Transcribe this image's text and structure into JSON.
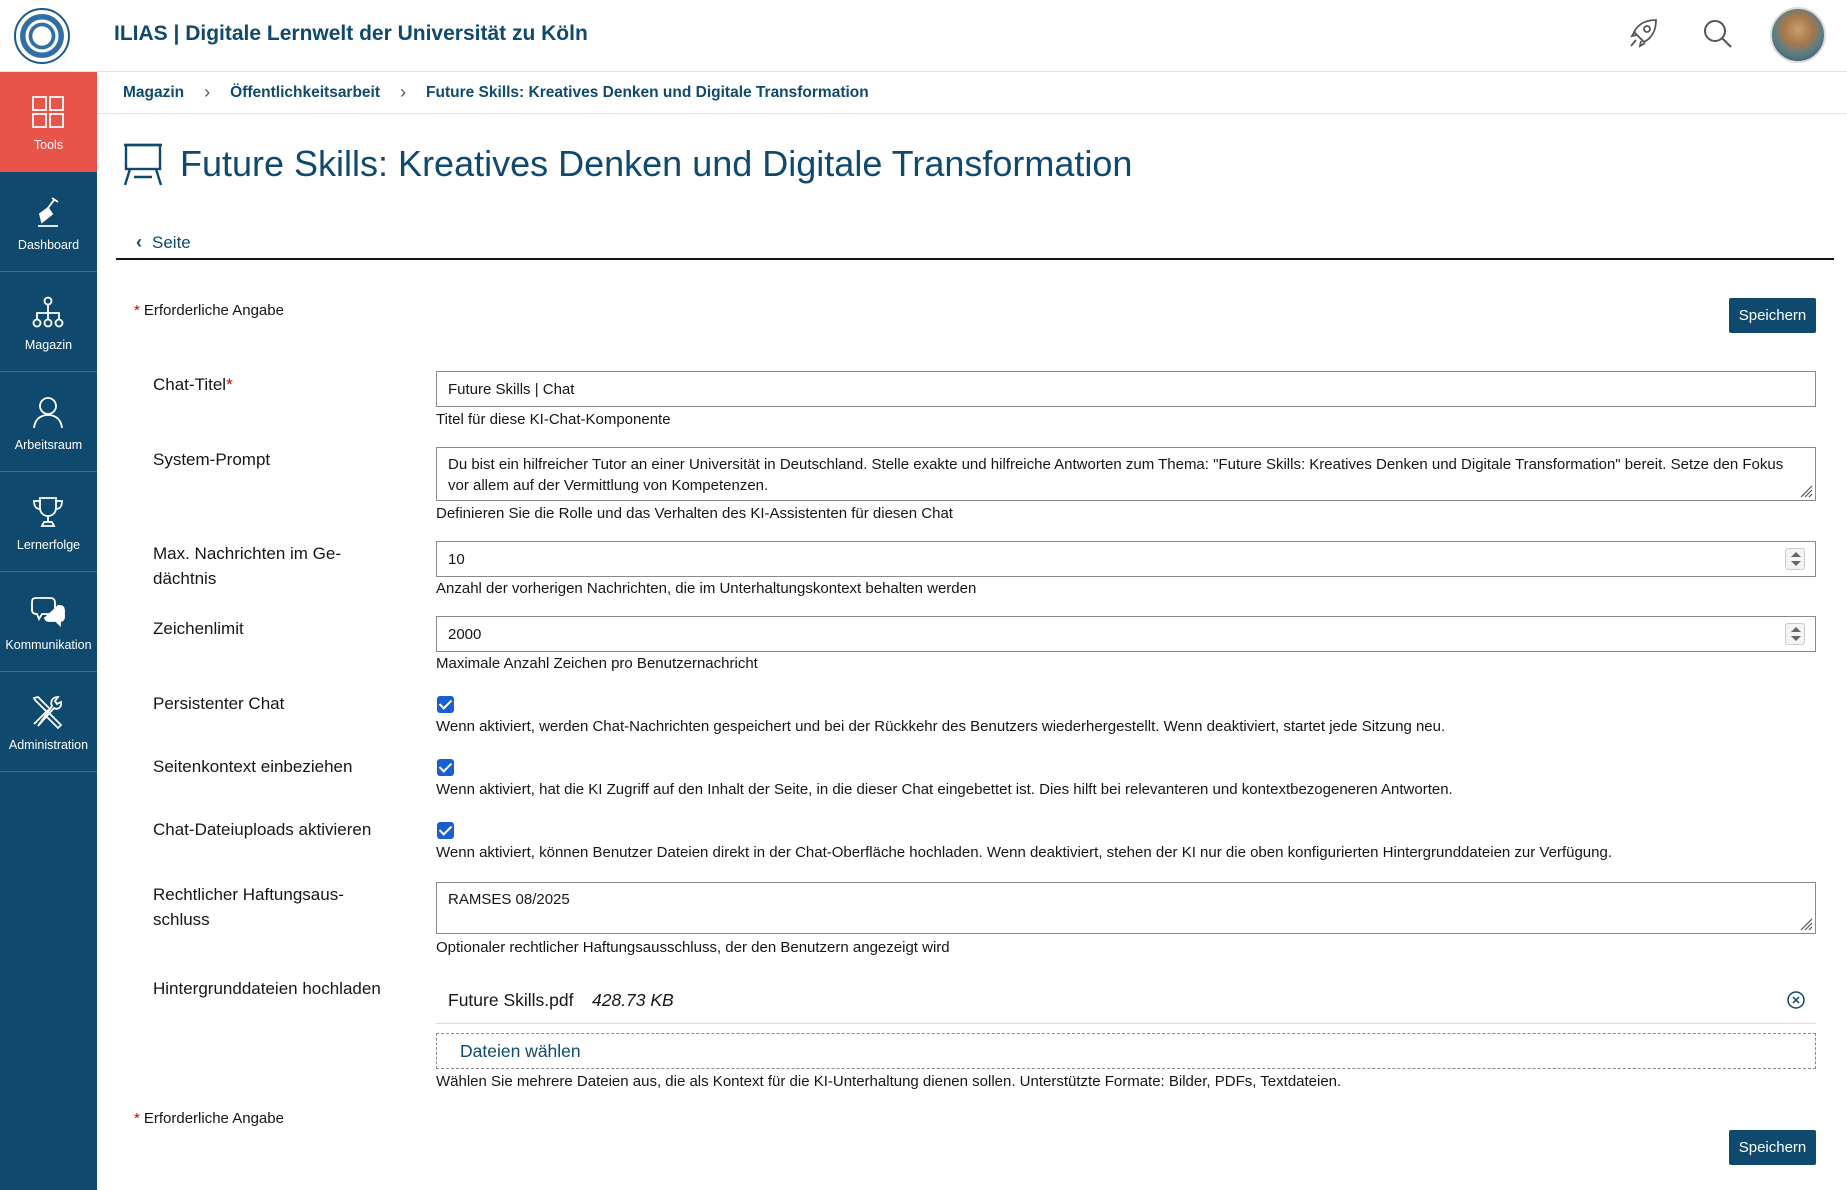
{
  "header": {
    "app_title": "ILIAS | Digitale Lernwelt der Universität zu Köln"
  },
  "sidebar": {
    "items": [
      {
        "label": "Tools",
        "icon": "tools-grid-icon",
        "active": true
      },
      {
        "label": "Dashboard",
        "icon": "dashboard-icon"
      },
      {
        "label": "Magazin",
        "icon": "magazin-tree-icon"
      },
      {
        "label": "Arbeitsraum",
        "icon": "person-icon"
      },
      {
        "label": "Lernerfolge",
        "icon": "trophy-icon"
      },
      {
        "label": "Kommunikation",
        "icon": "chat-bubbles-icon"
      },
      {
        "label": "Administration",
        "icon": "wrench-screwdriver-icon"
      }
    ]
  },
  "breadcrumb": [
    "Magazin",
    "Öffentlichkeitsarbeit",
    "Future Skills: Kreatives Denken und Digitale Transformation"
  ],
  "page": {
    "title": "Future Skills: Kreatives Denken und Digitale Transformation",
    "back_label": "Seite",
    "required_note": "Erforderliche Angabe",
    "save_label": "Speichern"
  },
  "form": {
    "chat_title": {
      "label": "Chat-Titel",
      "value": "Future Skills | Chat",
      "help": "Titel für diese KI-Chat-Komponente"
    },
    "system_prompt": {
      "label": "System-Prompt",
      "value": "Du bist ein hilfreicher Tutor an einer Universität in Deutschland. Stelle exakte und hilfreiche Antworten zum Thema: \"Future Skills: Kreatives Denken und Digitale Transformation\" bereit. Setze den Fokus vor allem auf der Vermittlung von Kompetenzen.",
      "help": "Definieren Sie die Rolle und das Verhalten des KI-Assistenten für diesen Chat"
    },
    "max_messages": {
      "label": "Max. Nachrichten im Ge­dächtnis",
      "value": "10",
      "help": "Anzahl der vorherigen Nachrichten, die im Unterhaltungskontext behalten werden"
    },
    "char_limit": {
      "label": "Zeichenlimit",
      "value": "2000",
      "help": "Maximale Anzahl Zeichen pro Benutzernachricht"
    },
    "persistent_chat": {
      "label": "Persistenter Chat",
      "checked": true,
      "help": "Wenn aktiviert, werden Chat-Nachrichten gespeichert und bei der Rückkehr des Benutzers wiederhergestellt. Wenn deaktiviert, startet jede Sitzung neu."
    },
    "page_context": {
      "label": "Seitenkontext einbeziehen",
      "checked": true,
      "help": "Wenn aktiviert, hat die KI Zugriff auf den Inhalt der Seite, in die dieser Chat eingebettet ist. Dies hilft bei relevanteren und kontextbezogeneren Antworten."
    },
    "file_uploads": {
      "label": "Chat-Dateiuploads aktivie­ren",
      "checked": true,
      "help": "Wenn aktiviert, können Benutzer Dateien direkt in der Chat-Oberfläche hochladen. Wenn deaktiviert, stehen der KI nur die oben konfigurierten Hintergrunddateien zur Verfügung."
    },
    "disclaimer": {
      "label": "Rechtlicher Haftungsaus­schluss",
      "value": "RAMSES 08/2025",
      "help": "Optionaler rechtlicher Haftungsausschluss, der den Benutzern angezeigt wird"
    },
    "background_files": {
      "label": "Hintergrunddateien hochla­den",
      "file_name": "Future Skills.pdf",
      "file_size": "428.73 KB",
      "choose_label": "Dateien wählen",
      "help": "Wählen Sie mehrere Dateien aus, die als Kontext für die KI-Unterhaltung dienen sollen. Unterstützte Formate: Bilder, PDFs, Textdateien."
    }
  },
  "colors": {
    "primary": "#0f4a6e",
    "active_tool": "#e8534a",
    "checkbox": "#1a5fd1",
    "required": "#cc0000"
  }
}
